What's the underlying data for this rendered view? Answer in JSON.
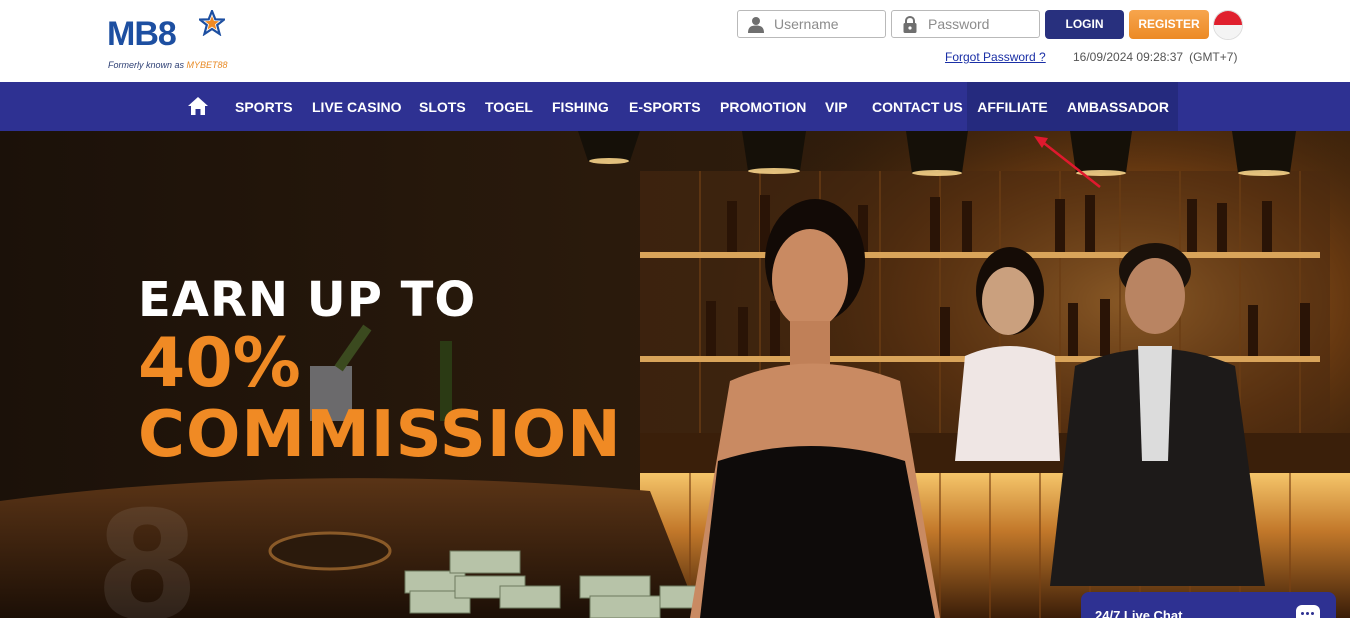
{
  "brand": {
    "logo_text": "MB8",
    "subtitle_prefix": "Formerly known as ",
    "subtitle_highlight": "MYBET88",
    "primary_color": "#2e3192",
    "accent_color": "#f08a24"
  },
  "login": {
    "username_placeholder": "Username",
    "password_placeholder": "Password",
    "login_label": "LOGIN",
    "register_label": "REGISTER",
    "forgot_label": "Forgot Password ?",
    "datetime": "16/09/2024 09:28:37",
    "timezone": "(GMT+7)",
    "language_flag": "indonesia-flag"
  },
  "nav": {
    "home_icon": "home-icon",
    "items": [
      {
        "label": "SPORTS"
      },
      {
        "label": "LIVE CASINO"
      },
      {
        "label": "SLOTS"
      },
      {
        "label": "TOGEL"
      },
      {
        "label": "FISHING"
      },
      {
        "label": "E-SPORTS"
      },
      {
        "label": "PROMOTION"
      },
      {
        "label": "VIP"
      },
      {
        "label": "CONTACT US"
      },
      {
        "label": "AFFILIATE"
      },
      {
        "label": "AMBASSADOR"
      }
    ]
  },
  "banner": {
    "line1": "EARN UP TO",
    "line2": "40%",
    "line3": "COMMISSION"
  },
  "chat": {
    "label": "24/7 Live Chat",
    "icon": "chat-bubble-icon"
  }
}
